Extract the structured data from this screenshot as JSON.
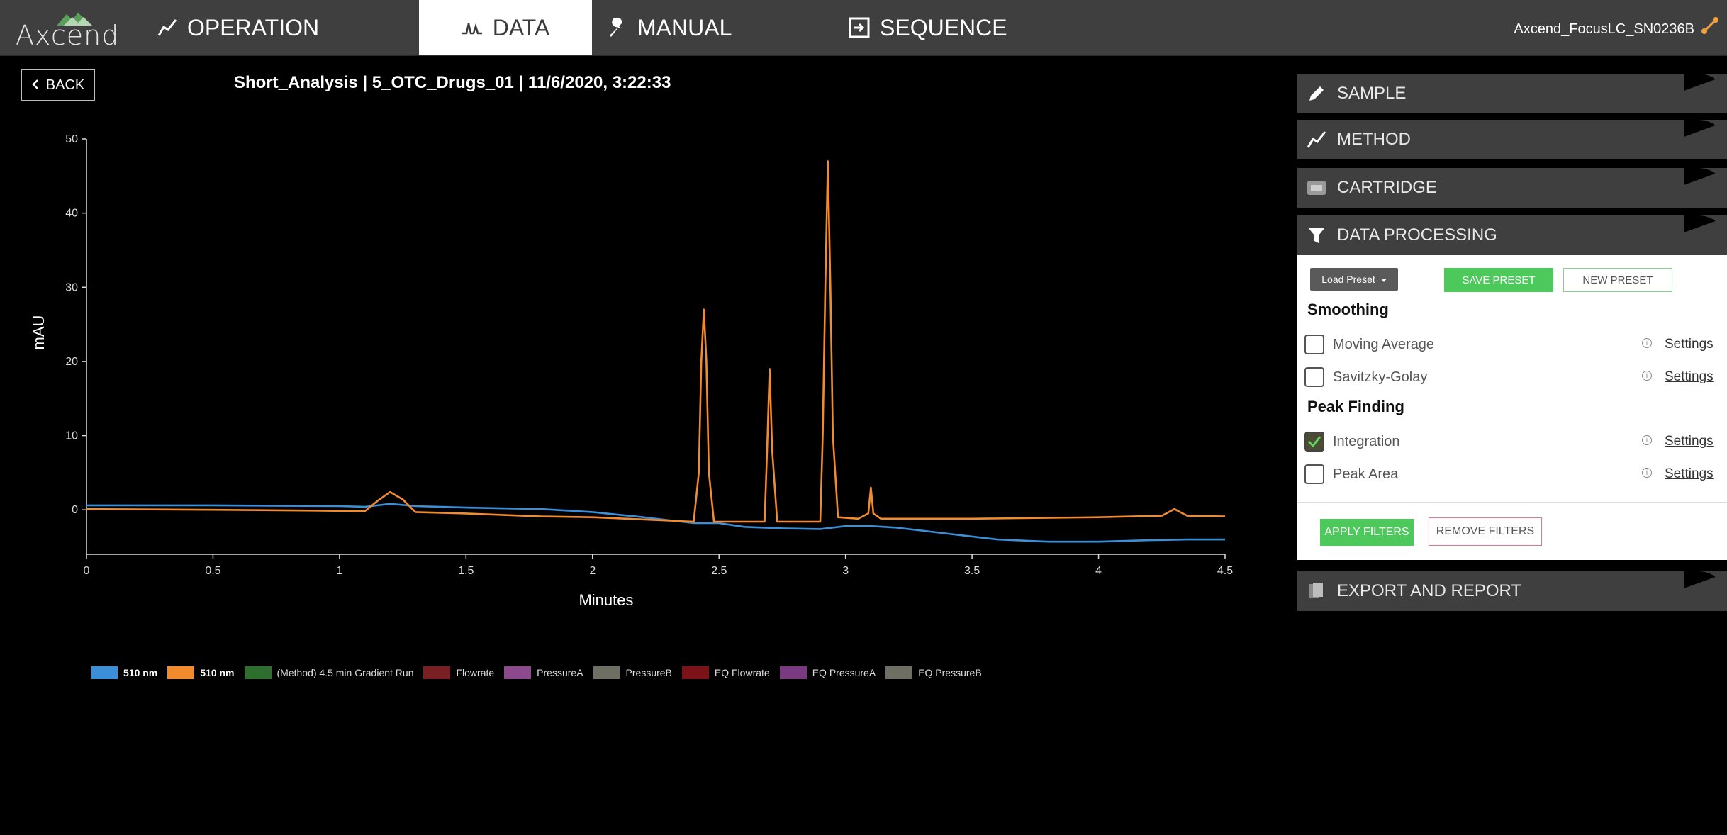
{
  "app": {
    "logo_text": "Axcend",
    "device_name": "Axcend_FocusLC_SN0236B"
  },
  "nav": {
    "tabs": [
      {
        "label": "OPERATION",
        "icon": "line-chart-icon",
        "active": false
      },
      {
        "label": "DATA",
        "icon": "peak-icon",
        "active": true
      },
      {
        "label": "MANUAL",
        "icon": "wrench-icon",
        "active": false
      },
      {
        "label": "SEQUENCE",
        "icon": "sequence-icon",
        "active": false
      }
    ]
  },
  "header": {
    "back_label": "BACK",
    "title": "Short_Analysis | 5_OTC_Drugs_01 | 11/6/2020, 3:22:33"
  },
  "chart_data": {
    "type": "line",
    "title": "",
    "xlabel": "Minutes",
    "ylabel": "mAU",
    "xlim": [
      0,
      4.5
    ],
    "ylim": [
      -6,
      50
    ],
    "x_ticks": [
      "0",
      "0.5",
      "1",
      "1.5",
      "2",
      "2.5",
      "3",
      "3.5",
      "4",
      "4.5"
    ],
    "y_ticks": [
      "0",
      "10",
      "20",
      "30",
      "40",
      "50"
    ],
    "grid": false,
    "legend_position": "bottom-left",
    "series": [
      {
        "name": "510 nm",
        "color": "#3b8fd8",
        "points": [
          [
            0,
            0.6
          ],
          [
            0.5,
            0.6
          ],
          [
            1,
            0.5
          ],
          [
            1.1,
            0.4
          ],
          [
            1.2,
            0.8
          ],
          [
            1.3,
            0.5
          ],
          [
            1.5,
            0.3
          ],
          [
            1.8,
            0.1
          ],
          [
            2.0,
            -0.3
          ],
          [
            2.2,
            -1.0
          ],
          [
            2.4,
            -1.8
          ],
          [
            2.5,
            -1.8
          ],
          [
            2.6,
            -2.3
          ],
          [
            2.75,
            -2.5
          ],
          [
            2.9,
            -2.6
          ],
          [
            3.0,
            -2.2
          ],
          [
            3.1,
            -2.2
          ],
          [
            3.2,
            -2.4
          ],
          [
            3.3,
            -2.8
          ],
          [
            3.5,
            -3.6
          ],
          [
            3.6,
            -4.0
          ],
          [
            3.8,
            -4.3
          ],
          [
            4.0,
            -4.3
          ],
          [
            4.2,
            -4.1
          ],
          [
            4.35,
            -4.0
          ],
          [
            4.5,
            -4.0
          ]
        ]
      },
      {
        "name": "510 nm",
        "color": "#f28a2e",
        "points": [
          [
            0,
            0.1
          ],
          [
            0.5,
            0.0
          ],
          [
            0.9,
            -0.1
          ],
          [
            1.1,
            -0.2
          ],
          [
            1.15,
            1.2
          ],
          [
            1.2,
            2.4
          ],
          [
            1.25,
            1.4
          ],
          [
            1.3,
            -0.3
          ],
          [
            1.5,
            -0.5
          ],
          [
            1.8,
            -0.9
          ],
          [
            2.0,
            -1.0
          ],
          [
            2.2,
            -1.3
          ],
          [
            2.4,
            -1.6
          ],
          [
            2.42,
            5
          ],
          [
            2.43,
            20
          ],
          [
            2.44,
            27
          ],
          [
            2.45,
            20
          ],
          [
            2.46,
            5
          ],
          [
            2.48,
            -1.6
          ],
          [
            2.68,
            -1.6
          ],
          [
            2.69,
            8
          ],
          [
            2.7,
            19
          ],
          [
            2.71,
            8
          ],
          [
            2.73,
            -1.6
          ],
          [
            2.9,
            -1.6
          ],
          [
            2.91,
            10
          ],
          [
            2.92,
            30
          ],
          [
            2.93,
            47
          ],
          [
            2.94,
            30
          ],
          [
            2.95,
            10
          ],
          [
            2.97,
            -1.0
          ],
          [
            3.05,
            -1.2
          ],
          [
            3.09,
            -0.5
          ],
          [
            3.1,
            3
          ],
          [
            3.11,
            -0.5
          ],
          [
            3.14,
            -1.2
          ],
          [
            3.5,
            -1.2
          ],
          [
            4.0,
            -1.0
          ],
          [
            4.25,
            -0.8
          ],
          [
            4.3,
            0.1
          ],
          [
            4.35,
            -0.8
          ],
          [
            4.5,
            -0.9
          ]
        ]
      }
    ],
    "legend": [
      {
        "name": "510 nm",
        "color": "#3b8fd8",
        "bold": true
      },
      {
        "name": "510 nm",
        "color": "#f28a2e",
        "bold": true
      },
      {
        "name": "(Method) 4.5 min Gradient Run",
        "color": "#2e6e2e",
        "bold": false
      },
      {
        "name": "Flowrate",
        "color": "#7a1f24",
        "bold": false
      },
      {
        "name": "PressureA",
        "color": "#8c4a8c",
        "bold": false
      },
      {
        "name": "PressureB",
        "color": "#6e6e62",
        "bold": false
      },
      {
        "name": "EQ Flowrate",
        "color": "#7a1218",
        "bold": false
      },
      {
        "name": "EQ PressureA",
        "color": "#7a3a80",
        "bold": false
      },
      {
        "name": "EQ PressureB",
        "color": "#6e6e62",
        "bold": false
      }
    ]
  },
  "panel": {
    "sections": [
      {
        "label": "SAMPLE",
        "icon": "pencil-icon"
      },
      {
        "label": "METHOD",
        "icon": "line-chart-icon"
      },
      {
        "label": "CARTRIDGE",
        "icon": "cartridge-icon"
      },
      {
        "label": "DATA PROCESSING",
        "icon": "filter-icon"
      },
      {
        "label": "EXPORT AND REPORT",
        "icon": "document-icon"
      }
    ],
    "data_processing": {
      "load_preset": "Load Preset",
      "save_preset": "SAVE PRESET",
      "new_preset": "NEW PRESET",
      "smoothing_title": "Smoothing",
      "peak_finding_title": "Peak Finding",
      "filters": [
        {
          "label": "Moving Average",
          "checked": false,
          "settings": "Settings"
        },
        {
          "label": "Savitzky-Golay",
          "checked": false,
          "settings": "Settings"
        },
        {
          "label": "Integration",
          "checked": true,
          "settings": "Settings"
        },
        {
          "label": "Peak Area",
          "checked": false,
          "settings": "Settings"
        }
      ],
      "apply_filters": "APPLY FILTERS",
      "remove_filters": "REMOVE FILTERS"
    }
  }
}
